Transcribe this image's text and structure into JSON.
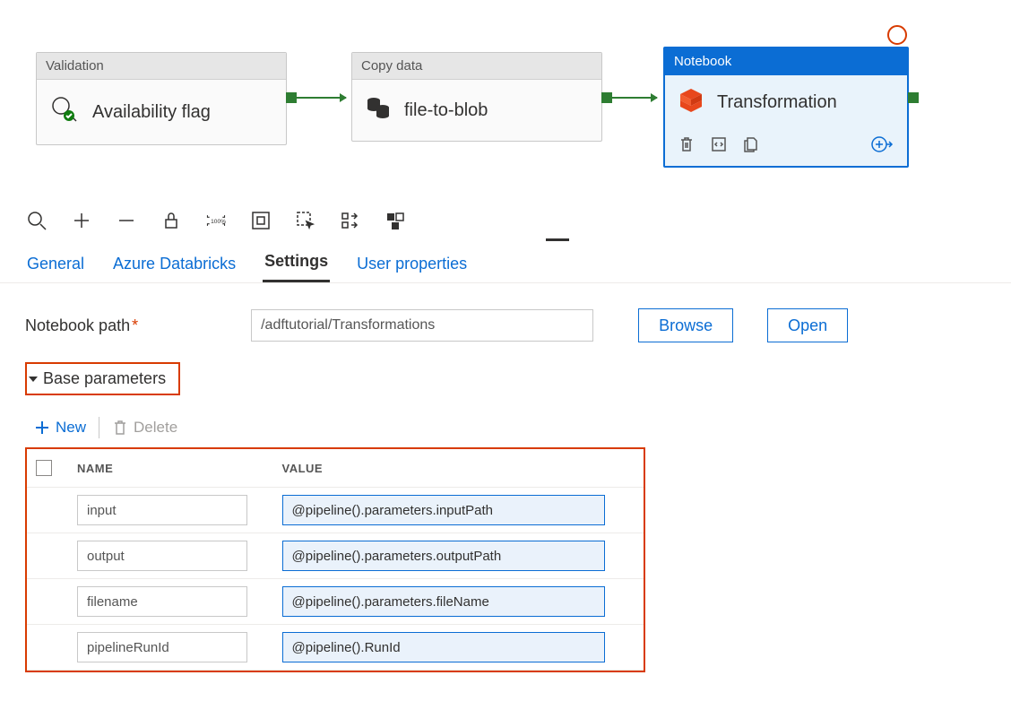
{
  "canvas": {
    "activities": [
      {
        "type": "Validation",
        "name": "Availability flag"
      },
      {
        "type": "Copy data",
        "name": "file-to-blob"
      },
      {
        "type": "Notebook",
        "name": "Transformation"
      }
    ]
  },
  "tabs": {
    "general": "General",
    "databricks": "Azure Databricks",
    "settings": "Settings",
    "userprops": "User properties"
  },
  "settings": {
    "notebook_path_label": "Notebook path",
    "notebook_path_value": "/adftutorial/Transformations",
    "browse": "Browse",
    "open": "Open",
    "base_params_label": "Base parameters",
    "new_label": "New",
    "delete_label": "Delete",
    "col_name": "NAME",
    "col_value": "VALUE",
    "params": [
      {
        "name": "input",
        "value": "@pipeline().parameters.inputPath"
      },
      {
        "name": "output",
        "value": "@pipeline().parameters.outputPath"
      },
      {
        "name": "filename",
        "value": "@pipeline().parameters.fileName"
      },
      {
        "name": "pipelineRunId",
        "value": "@pipeline().RunId"
      }
    ]
  }
}
